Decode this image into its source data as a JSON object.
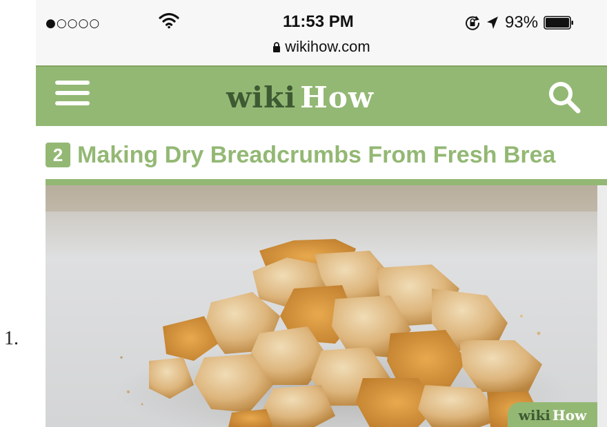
{
  "list": {
    "marker": "1."
  },
  "status_bar": {
    "signal": "●○○○○",
    "time": "11:53 PM",
    "battery_percent": "93%",
    "url": "wikihow.com",
    "icons": [
      "wifi-icon",
      "rotation-lock-icon",
      "location-arrow-icon",
      "battery-icon",
      "lock-icon"
    ]
  },
  "header": {
    "logo_wiki": "wiki",
    "logo_how": "How",
    "brand_color": "#93b874",
    "logo_dark_color": "#3e5a33",
    "icons": [
      "hamburger-menu-icon",
      "search-icon"
    ]
  },
  "step": {
    "number": "2",
    "title": "Making Dry Breadcrumbs From Fresh Brea"
  },
  "image": {
    "subject": "pile of dry torn bread pieces on a white cutting board",
    "watermark_wiki": "wiki",
    "watermark_how": "How"
  }
}
